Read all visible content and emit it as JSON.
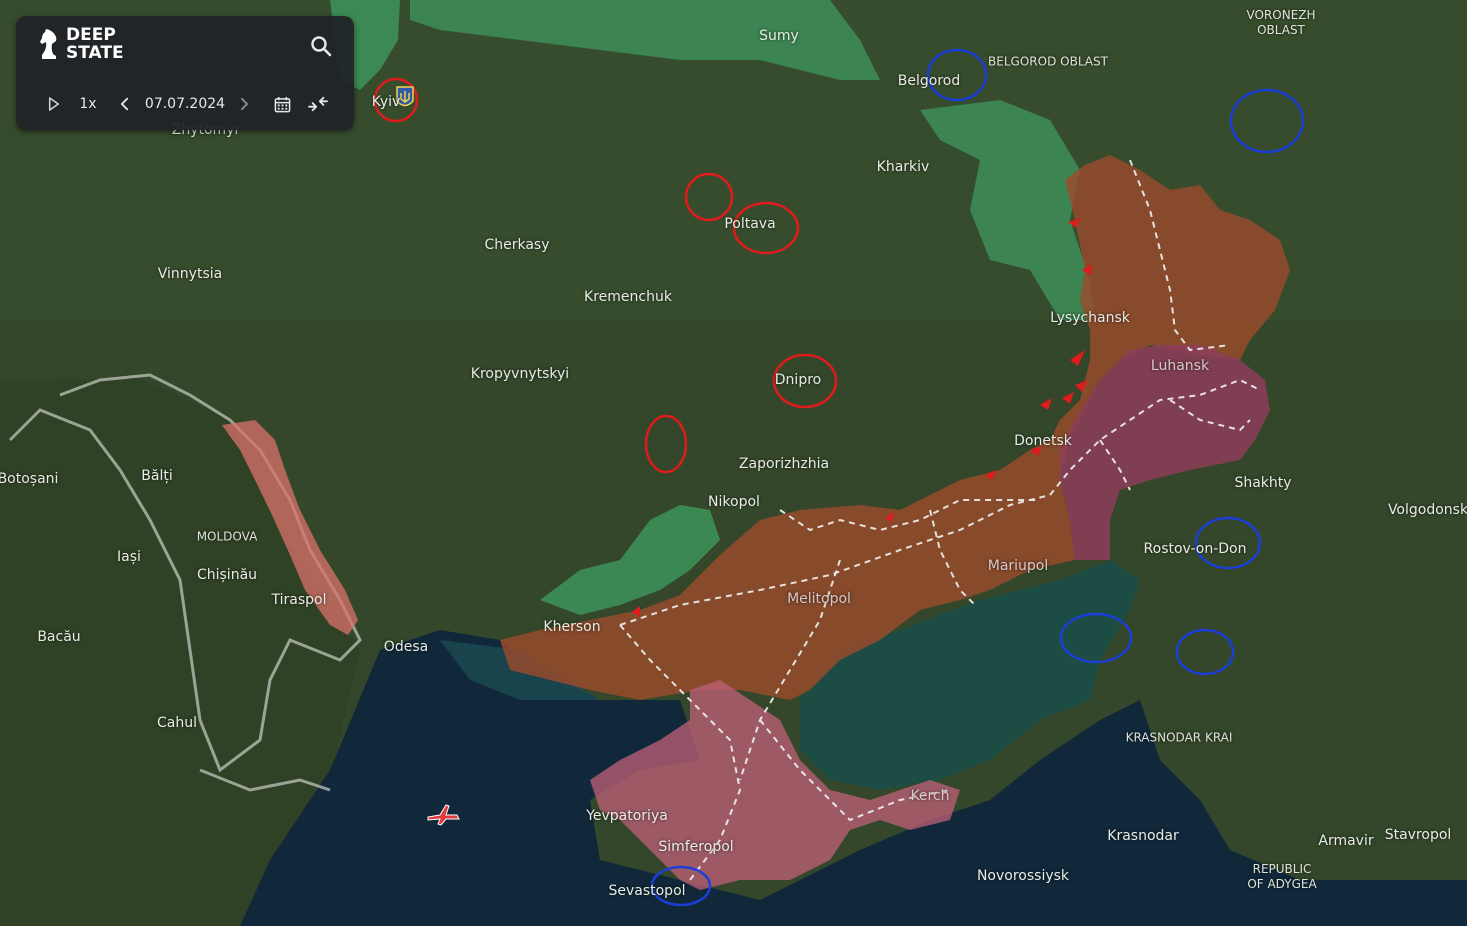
{
  "app": {
    "brand_line1": "DEEP",
    "brand_line2": "STATE"
  },
  "toolbar": {
    "search_icon": "search-icon",
    "play_icon": "play-icon",
    "speed_label": "1x",
    "prev_icon": "chevron-left-icon",
    "date": "07.07.2024",
    "next_icon": "chevron-right-icon",
    "calendar_icon": "calendar-icon",
    "compare_icon": "compare-arrows-icon"
  },
  "colors": {
    "ukraine_liberated": "#3f9d62",
    "occupied_recent": "#9a4a2c",
    "occupied_before_2022": "#8e3d5a",
    "transnistria": "#d9716a",
    "annotation_red": "#e01b1b",
    "annotation_blue": "#1a3fd6",
    "panel_bg": "#212328"
  },
  "places": {
    "sumy": "Sumy",
    "belgorod": "Belgorod",
    "belgorod_oblast": "BELGOROD OBLAST",
    "voronezh_oblast": "VORONEZH\nOBLAST",
    "kyiv": "Kyiv",
    "zhytomyr": "Zhytomyr",
    "kharkiv": "Kharkiv",
    "poltava": "Poltava",
    "cherkasy": "Cherkasy",
    "vinnytsia": "Vinnytsia",
    "kremenchuk": "Kremenchuk",
    "lysychansk": "Lysychansk",
    "luhansk": "Luhansk",
    "kropyvnytskyi": "Kropyvnytskyi",
    "dnipro": "Dnipro",
    "donetsk": "Donetsk",
    "botosani": "Botoșani",
    "balti": "Bălți",
    "moldova": "MOLDOVA",
    "zaporizhzhia": "Zaporizhzhia",
    "shakhty": "Shakhty",
    "nikopol": "Nikopol",
    "volgodonsk": "Volgodonsk",
    "iasi": "Iași",
    "chisinau": "Chișinău",
    "rostov": "Rostov-on-Don",
    "mariupol": "Mariupol",
    "tiraspol": "Tiraspol",
    "melitopol": "Melitopol",
    "kherson": "Kherson",
    "bacau": "Bacău",
    "odesa": "Odesa",
    "cahul": "Cahul",
    "krasnodar_krai": "KRASNODAR KRAI",
    "kerch": "Kerch",
    "yevpatoriya": "Yevpatoriya",
    "krasnodar": "Krasnodar",
    "armavir": "Armavir",
    "stavropol": "Stavropol",
    "simferopol": "Simferopol",
    "republic_adygea": "REPUBLIC\nOF ADYGEA",
    "novorossiysk": "Novorossiysk",
    "sevastopol": "Sevastopol"
  }
}
